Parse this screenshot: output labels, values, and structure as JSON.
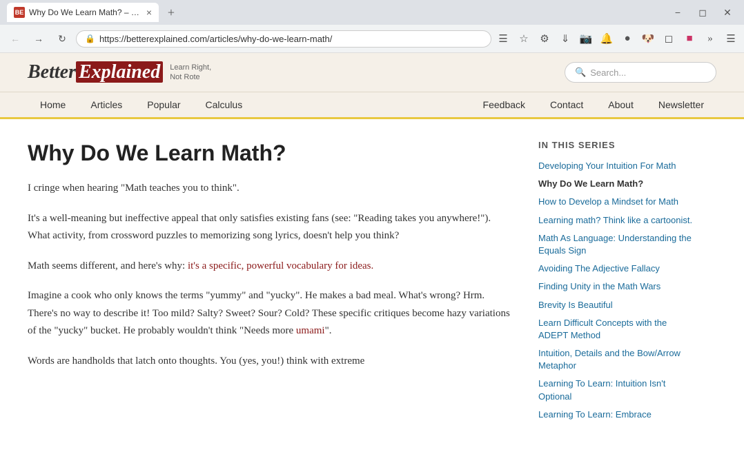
{
  "browser": {
    "tab_favicon": "BE",
    "tab_title": "Why Do We Learn Math? – B...",
    "address": "https://betterexplained.com/articles/why-do-we-learn-math/",
    "new_tab_label": "+",
    "close_label": "×"
  },
  "header": {
    "logo_better": "Better",
    "logo_explained": "Explained",
    "tagline_line1": "Learn Right,",
    "tagline_line2": "Not Rote",
    "search_placeholder": "Search..."
  },
  "nav": {
    "left_links": [
      "Home",
      "Articles",
      "Popular",
      "Calculus"
    ],
    "right_links": [
      "Feedback",
      "Contact",
      "About",
      "Newsletter"
    ]
  },
  "article": {
    "title": "Why Do We Learn Math?",
    "paragraph1": "I cringe when hearing \"Math teaches you to think\".",
    "paragraph2": "It's a well-meaning but ineffective appeal that only satisfies existing fans (see: \"Reading takes you anywhere!\"). What activity, from crossword puzzles to memorizing song lyrics, doesn't help you think?",
    "paragraph3_before": "Math seems different, and here's why: ",
    "paragraph3_highlight": "it's a specific, powerful vocabulary for ideas.",
    "paragraph4": "Imagine a cook who only knows the terms \"yummy\" and \"yucky\". He makes a bad meal. What's wrong? Hrm. There's no way to describe it! Too mild? Salty? Sweet? Sour? Cold? These specific critiques become hazy variations of the \"yucky\" bucket. He probably wouldn't think \"Needs more ",
    "paragraph4_link": "umami",
    "paragraph4_after": "\".",
    "paragraph5": "Words are handholds that latch onto thoughts. You (yes, you!) think with extreme"
  },
  "sidebar": {
    "series_heading": "IN THIS SERIES",
    "items": [
      {
        "label": "Developing Your Intuition For Math",
        "current": false
      },
      {
        "label": "Why Do We Learn Math?",
        "current": true
      },
      {
        "label": "How to Develop a Mindset for Math",
        "current": false
      },
      {
        "label": "Learning math? Think like a cartoonist.",
        "current": false
      },
      {
        "label": "Math As Language: Understanding the Equals Sign",
        "current": false
      },
      {
        "label": "Avoiding The Adjective Fallacy",
        "current": false
      },
      {
        "label": "Finding Unity in the Math Wars",
        "current": false
      },
      {
        "label": "Brevity Is Beautiful",
        "current": false
      },
      {
        "label": "Learn Difficult Concepts with the ADEPT Method",
        "current": false
      },
      {
        "label": "Intuition, Details and the Bow/Arrow Metaphor",
        "current": false
      },
      {
        "label": "Learning To Learn: Intuition Isn't Optional",
        "current": false
      },
      {
        "label": "Learning To Learn: Embrace",
        "current": false
      }
    ]
  }
}
